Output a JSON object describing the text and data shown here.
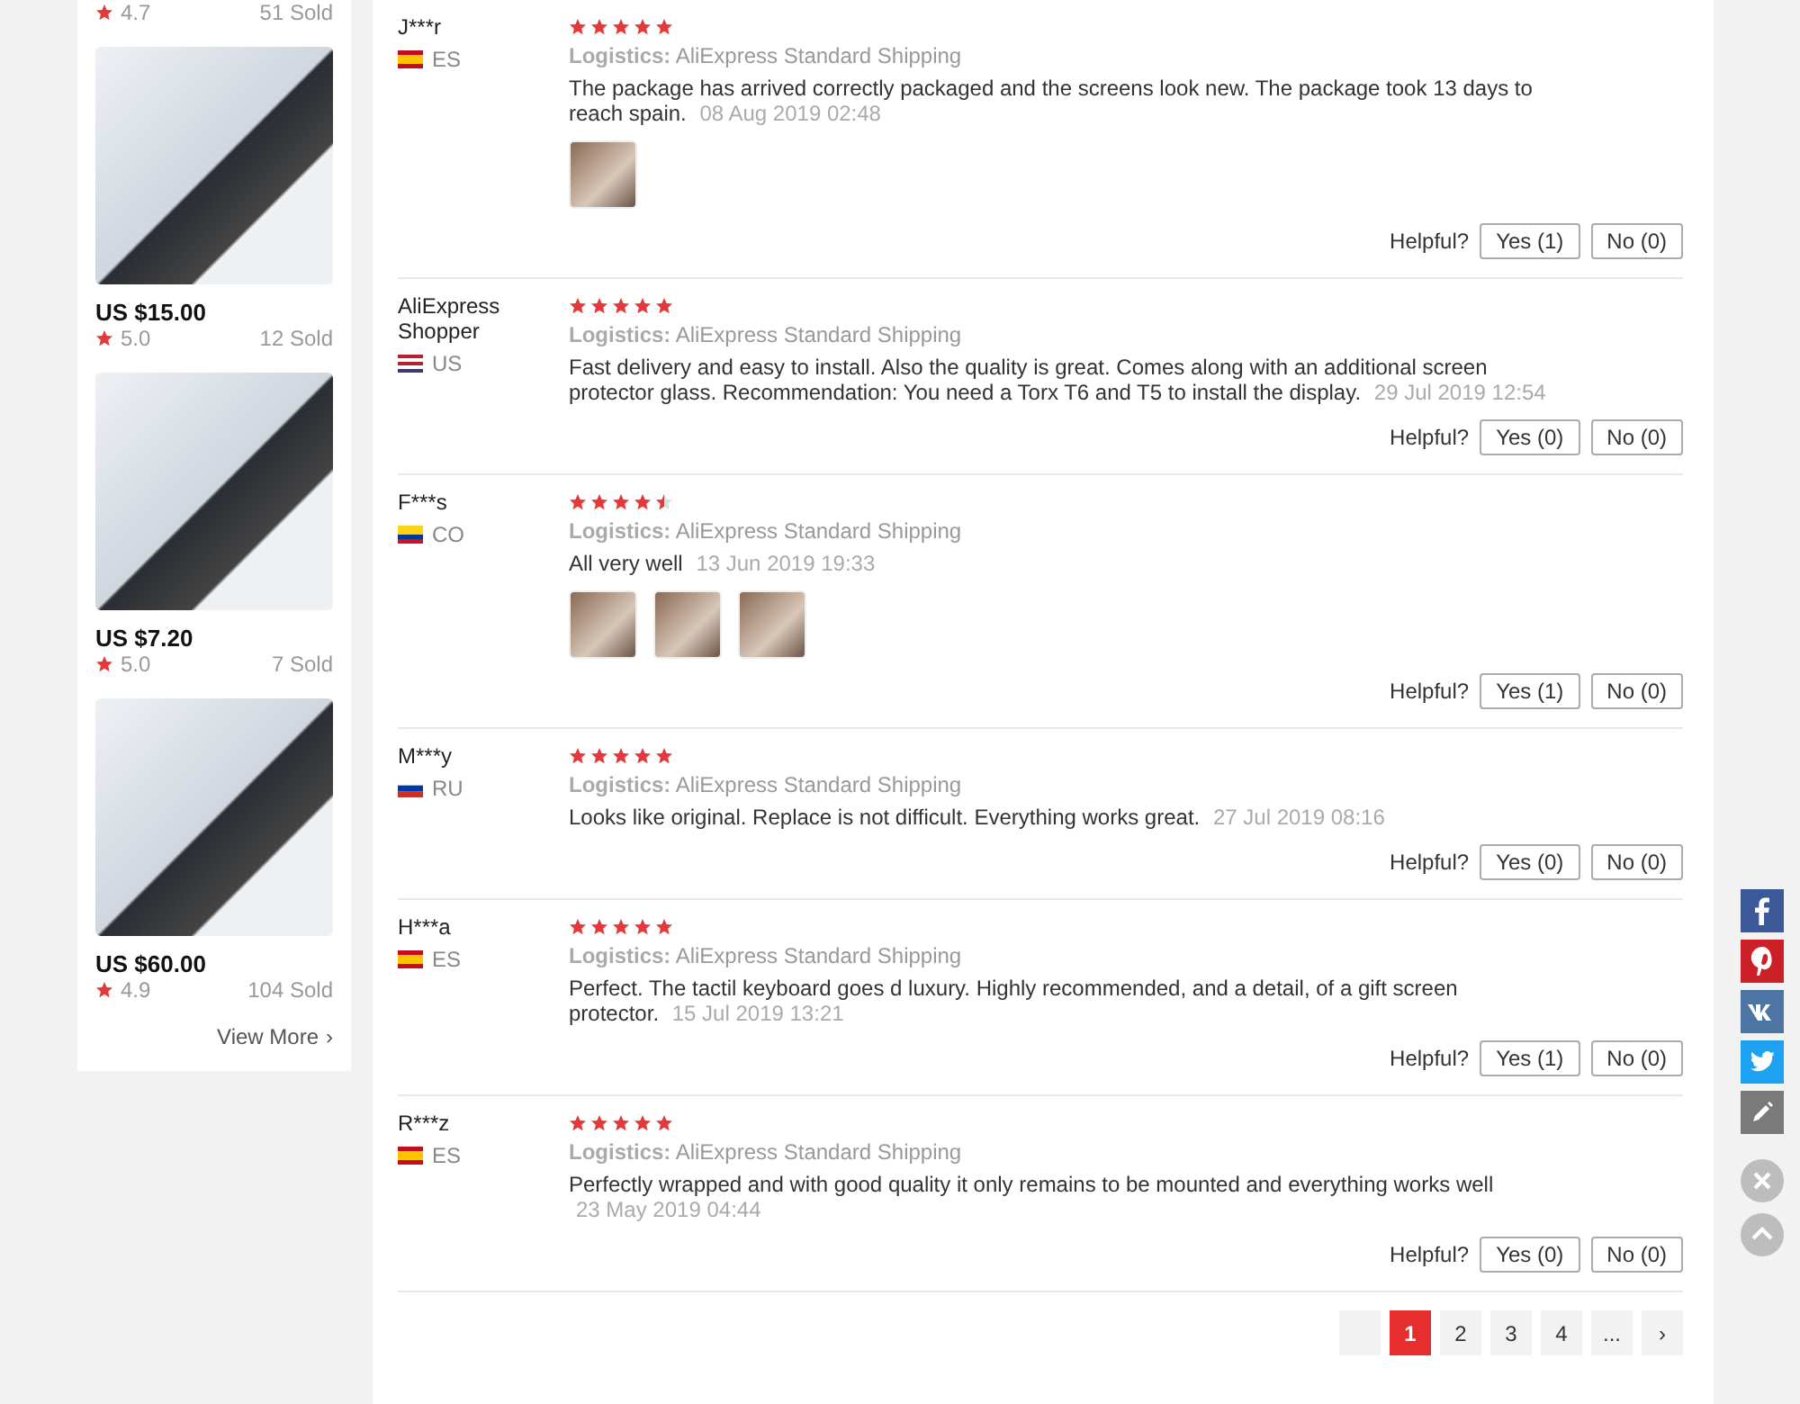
{
  "products_top": {
    "rating": "4.7",
    "sold": "51 Sold"
  },
  "products": [
    {
      "price": "US $15.00",
      "rating": "5.0",
      "sold": "12 Sold"
    },
    {
      "price": "US $7.20",
      "rating": "5.0",
      "sold": "7 Sold"
    },
    {
      "price": "US $60.00",
      "rating": "4.9",
      "sold": "104 Sold"
    }
  ],
  "view_more": "View More",
  "view_more_arrow": "›",
  "reviews": [
    {
      "name": "J***r",
      "kind": "spain",
      "country": "ES",
      "stars": 5,
      "logistics_label": "Logistics:",
      "logistics": "AliExpress Standard Shipping",
      "comment": "The package has arrived correctly packaged and the screens look new. The package took 13 days to reach spain.",
      "date": "08 Aug 2019 02:48",
      "photos": [
        {
          "kind": "thumbnail"
        }
      ],
      "helpful": "Helpful?",
      "yes": "Yes (1)",
      "no": "No (0)"
    },
    {
      "name": "AliExpress Shopper",
      "kind": "usa",
      "country": "US",
      "stars": 5,
      "logistics_label": "Logistics:",
      "logistics": "AliExpress Standard Shipping",
      "comment": "Fast delivery and easy to install. Also the quality is great. Comes along with an additional screen protector glass. Recommendation: You need a Torx T6 and T5 to install the display.",
      "date": "29 Jul 2019 12:54",
      "helpful": "Helpful?",
      "yes": "Yes (0)",
      "no": "No (0)"
    },
    {
      "name": "F***s",
      "kind": "colombia",
      "country": "CO",
      "stars": 4.5,
      "logistics_label": "Logistics:",
      "logistics": "AliExpress Standard Shipping",
      "comment": "All very well",
      "date": "13 Jun 2019 19:33",
      "photos": [
        {
          "kind": "thumbnail"
        },
        {
          "kind": "thumbnail"
        },
        {
          "kind": "thumbnail"
        }
      ],
      "helpful": "Helpful?",
      "yes": "Yes (1)",
      "no": "No (0)"
    },
    {
      "name": "M***y",
      "kind": "russia",
      "country": "RU",
      "stars": 5,
      "logistics_label": "Logistics:",
      "logistics": "AliExpress Standard Shipping",
      "comment": "Looks like original. Replace is not difficult. Everything works great.",
      "date": "27 Jul 2019 08:16",
      "helpful": "Helpful?",
      "yes": "Yes (0)",
      "no": "No (0)"
    },
    {
      "name": "H***a",
      "kind": "spain",
      "country": "ES",
      "stars": 5,
      "logistics_label": "Logistics:",
      "logistics": "AliExpress Standard Shipping",
      "comment": "Perfect. The tactil keyboard goes d luxury. Highly recommended, and a detail, of a gift screen protector.",
      "date": "15 Jul 2019 13:21",
      "helpful": "Helpful?",
      "yes": "Yes (1)",
      "no": "No (0)"
    },
    {
      "name": "R***z",
      "kind": "spain",
      "country": "ES",
      "stars": 5,
      "logistics_label": "Logistics:",
      "logistics": "AliExpress Standard Shipping",
      "comment": "Perfectly wrapped and with good quality it only remains to be mounted and everything works well",
      "date": "23 May 2019 04:44",
      "helpful": "Helpful?",
      "yes": "Yes (0)",
      "no": "No (0)"
    }
  ],
  "pagination": {
    "pages": [
      {
        "label": "1",
        "selected": true
      },
      {
        "label": "2",
        "selected": false
      },
      {
        "label": "3",
        "selected": false
      },
      {
        "label": "4",
        "selected": false
      }
    ],
    "ellipsis": "...",
    "next": "›"
  },
  "share": [
    {
      "kind": "facebook"
    },
    {
      "kind": "pinterest"
    },
    {
      "kind": "vk"
    },
    {
      "kind": "twitter"
    },
    {
      "kind": "edit"
    }
  ],
  "float_buttons": [
    {
      "kind": "close"
    },
    {
      "kind": "top"
    }
  ]
}
